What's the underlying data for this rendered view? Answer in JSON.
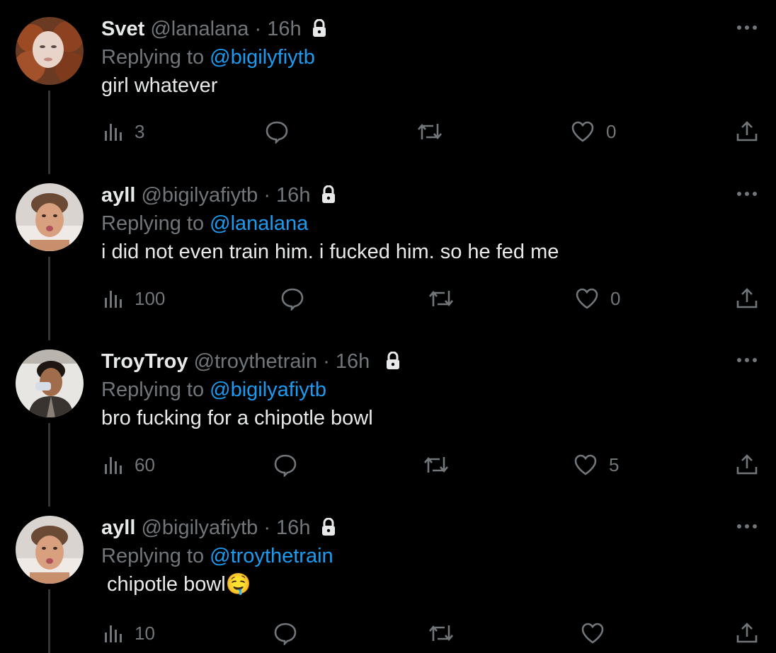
{
  "tweets": [
    {
      "name": "Svet",
      "handle": "@lanalana",
      "time": "· 16h",
      "replying_prefix": "Replying to ",
      "replying_to": "@bigilyfiytb",
      "text": "girl whatever",
      "views": "3",
      "replies": "",
      "retweets": "",
      "likes": "0",
      "avatar": "red-curly-hair-avatar"
    },
    {
      "name": "ayll",
      "handle": "@bigilyafiytb",
      "time": "· 16h",
      "replying_prefix": "Replying to ",
      "replying_to": "@lanalana",
      "text": "i did not even train him. i fucked him. so he fed me",
      "views": "100",
      "replies": "",
      "retweets": "",
      "likes": "0",
      "avatar": "man-selfie-avatar"
    },
    {
      "name": "TroyTroy",
      "handle": "@troythetrain",
      "time": "· 16h",
      "replying_prefix": "Replying to ",
      "replying_to": "@bigilyafiytb",
      "text": "bro fucking for a chipotle bowl",
      "views": "60",
      "replies": "",
      "retweets": "",
      "likes": "5",
      "avatar": "man-drinking-avatar"
    },
    {
      "name": "ayll",
      "handle": "@bigilyafiytb",
      "time": "· 16h",
      "replying_prefix": "Replying to ",
      "replying_to": "@troythetrain",
      "text": " chipotle bowl🤤",
      "views": "10",
      "replies": "",
      "retweets": "",
      "likes": "",
      "avatar": "man-selfie-avatar"
    }
  ],
  "colors": {
    "background": "#000000",
    "text": "#e7e9ea",
    "muted": "#71767b",
    "link": "#1d9bf0"
  }
}
